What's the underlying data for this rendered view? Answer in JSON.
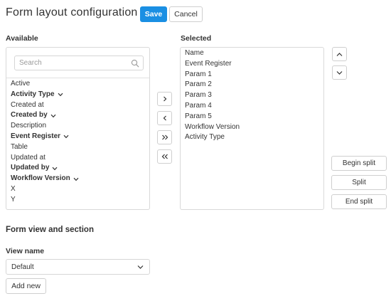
{
  "header": {
    "title": "Form layout configuration",
    "save_label": "Save",
    "cancel_label": "Cancel"
  },
  "available": {
    "heading": "Available",
    "search": {
      "placeholder": "Search",
      "value": ""
    },
    "items": [
      {
        "label": "Active",
        "group": false
      },
      {
        "label": "Activity Type",
        "group": true
      },
      {
        "label": "Created at",
        "group": false
      },
      {
        "label": "Created by",
        "group": true
      },
      {
        "label": "Description",
        "group": false
      },
      {
        "label": "Event Register",
        "group": true
      },
      {
        "label": "Table",
        "group": false
      },
      {
        "label": "Updated at",
        "group": false
      },
      {
        "label": "Updated by",
        "group": true
      },
      {
        "label": "Workflow Version",
        "group": true
      },
      {
        "label": "X",
        "group": false
      },
      {
        "label": "Y",
        "group": false
      }
    ]
  },
  "selected": {
    "heading": "Selected",
    "items": [
      "Name",
      "Event Register",
      "Param 1",
      "Param 2",
      "Param 3",
      "Param 4",
      "Param 5",
      "Workflow Version",
      "Activity Type"
    ]
  },
  "split": {
    "begin_label": "Begin split",
    "split_label": "Split",
    "end_label": "End split"
  },
  "form_view": {
    "title": "Form view and section",
    "view_name_label": "View name",
    "view_name_value": "Default",
    "add_new_label": "Add new"
  },
  "colors": {
    "primary": "#1a8fe3",
    "border": "#d9d9d9",
    "text": "#333333"
  }
}
